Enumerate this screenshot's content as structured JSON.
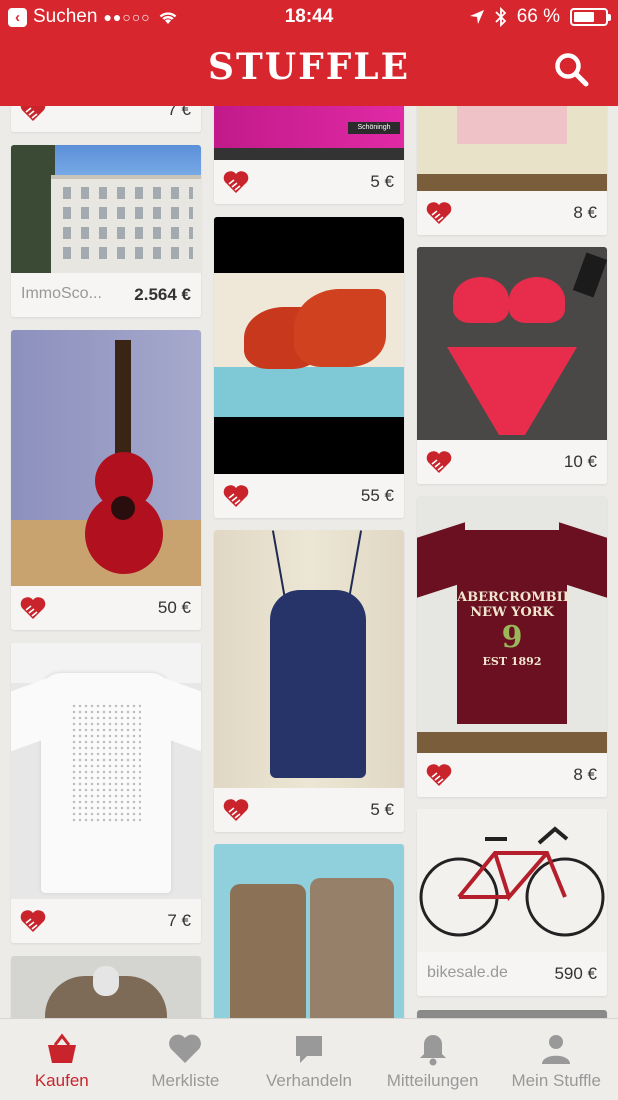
{
  "status_bar": {
    "back_label": "Suchen",
    "signal": "●●○○○",
    "time": "18:44",
    "battery": "66 %",
    "battery_fraction": 0.66
  },
  "header": {
    "logo": "STUFFLE"
  },
  "colors": {
    "brand_red": "#d8262f",
    "tab_active": "#c9242c"
  },
  "feed": {
    "col1": [
      {
        "price": "7 €",
        "seller": ""
      },
      {
        "price": "2.564 €",
        "seller": "ImmoSco..."
      },
      {
        "price": "50 €",
        "seller": ""
      },
      {
        "price": "7 €",
        "seller": ""
      }
    ],
    "col2": [
      {
        "price": "5 €",
        "seller": "",
        "image_text": "Schöningh"
      },
      {
        "price": "55 €",
        "seller": ""
      },
      {
        "price": "5 €",
        "seller": ""
      }
    ],
    "col3": [
      {
        "price": "8 €",
        "seller": ""
      },
      {
        "price": "10 €",
        "seller": ""
      },
      {
        "price": "8 €",
        "seller": "",
        "shirt_text_1": "ABERCROMBIE",
        "shirt_text_2": "NEW YORK",
        "shirt_text_3": "9",
        "shirt_text_4": "EST 1892"
      },
      {
        "price": "590 €",
        "seller": "bikesale.de"
      }
    ]
  },
  "tabs": [
    {
      "label": "Kaufen",
      "icon": "basket-icon",
      "active": true
    },
    {
      "label": "Merkliste",
      "icon": "heart-icon",
      "active": false
    },
    {
      "label": "Verhandeln",
      "icon": "chat-bubble-icon",
      "active": false
    },
    {
      "label": "Mitteilungen",
      "icon": "bell-icon",
      "active": false
    },
    {
      "label": "Mein Stuffle",
      "icon": "person-icon",
      "active": false
    }
  ]
}
